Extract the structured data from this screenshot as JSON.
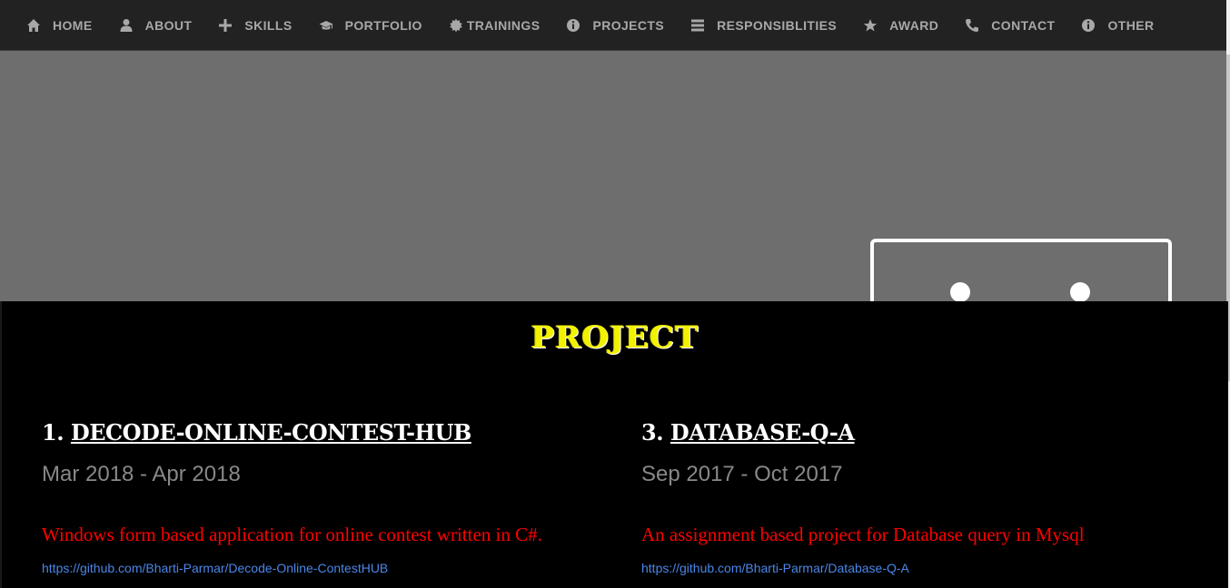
{
  "nav": {
    "items": [
      {
        "label": "HOME",
        "icon": "home-icon"
      },
      {
        "label": "ABOUT",
        "icon": "user-icon"
      },
      {
        "label": "SKILLS",
        "icon": "plus-icon"
      },
      {
        "label": "PORTFOLIO",
        "icon": "graduation-cap-icon"
      },
      {
        "label": "TRAININGS",
        "icon": "certificate-icon"
      },
      {
        "label": "PROJECTS",
        "icon": "info-icon"
      },
      {
        "label": "RESPONSIBLITIES",
        "icon": "tasks-icon"
      },
      {
        "label": "AWARD",
        "icon": "star-icon"
      },
      {
        "label": "CONTACT",
        "icon": "phone-icon"
      },
      {
        "label": "OTHER",
        "icon": "info-icon"
      }
    ]
  },
  "section": {
    "title": "PROJECT"
  },
  "projects": [
    {
      "number": "1.",
      "title": "DECODE-ONLINE-CONTEST-HUB",
      "dates": "Mar 2018 - Apr 2018",
      "description": "Windows form based application for online contest written in C#.",
      "url": "https://github.com/Bharti-Parmar/Decode-Online-ContestHUB"
    },
    {
      "number": "3.",
      "title": "DATABASE-Q-A",
      "dates": "Sep 2017 - Oct 2017",
      "description": "An assignment based project for Database query in Mysql",
      "url": "https://github.com/Bharti-Parmar/Database-Q-A"
    }
  ],
  "colors": {
    "nav_bg": "#222222",
    "nav_text": "#a8a8a8",
    "hero_bg": "#6e6e6e",
    "section_bg": "#000000",
    "title": "#f2f200",
    "description": "#ff0000",
    "link": "#4a86e8",
    "dates": "#888888"
  }
}
